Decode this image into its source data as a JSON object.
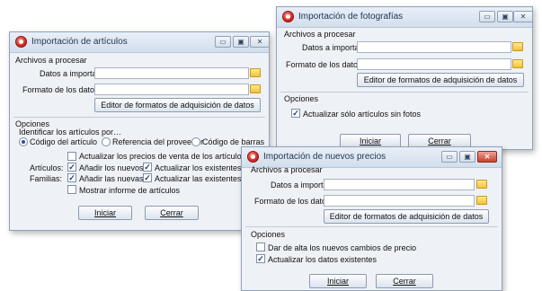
{
  "colors": {
    "accent": "#2a4f9a",
    "window_bg": "#eef1f6",
    "close_red": "#c9402c"
  },
  "win_articulos": {
    "title": "Importación de artículos",
    "section_files": "Archivos a procesar",
    "data_label": "Datos a importar:",
    "format_label": "Formato de los datos:",
    "editor_button": "Editor de formatos de adquisición de datos",
    "section_options": "Opciones",
    "identify_label": "Identificar los artículos por…",
    "radios": [
      {
        "label": "Código del artículo",
        "checked": true
      },
      {
        "label": "Referencia del proveedor",
        "checked": false
      },
      {
        "label": "Código de barras",
        "checked": false
      }
    ],
    "update_prices": "Actualizar los precios de venta de los artículos",
    "articles_row_label": "Artículos:",
    "add_new_articles": "Añadir los nuevos",
    "update_existing_articles": "Actualizar los existentes",
    "families_row_label": "Familias:",
    "add_new_families": "Añadir las nuevas",
    "update_existing_families": "Actualizar las existentes",
    "show_report": "Mostrar informe de artículos",
    "start_button": "Iniciar",
    "close_button": "Cerrar"
  },
  "win_fotos": {
    "title": "Importación de fotografías",
    "section_files": "Archivos a procesar",
    "data_label": "Datos a importar:",
    "format_label": "Formato de los datos:",
    "editor_button": "Editor de formatos de adquisición de datos",
    "section_options": "Opciones",
    "only_without_photos": "Actualizar sólo artículos sin fotos",
    "start_button": "Iniciar",
    "close_button": "Cerrar"
  },
  "win_precios": {
    "title": "Importación de nuevos precios",
    "section_files": "Archivos a procesar",
    "data_label": "Datos a importar:",
    "format_label": "Formato de los datos:",
    "editor_button": "Editor de formatos de adquisición de datos",
    "section_options": "Opciones",
    "register_changes": "Dar de alta los nuevos cambios de precio",
    "update_existing": "Actualizar los datos existentes",
    "start_button": "Iniciar",
    "close_button": "Cerrar"
  },
  "controls": {
    "minimize": "▭",
    "maximize": "▣",
    "close": "✕"
  }
}
